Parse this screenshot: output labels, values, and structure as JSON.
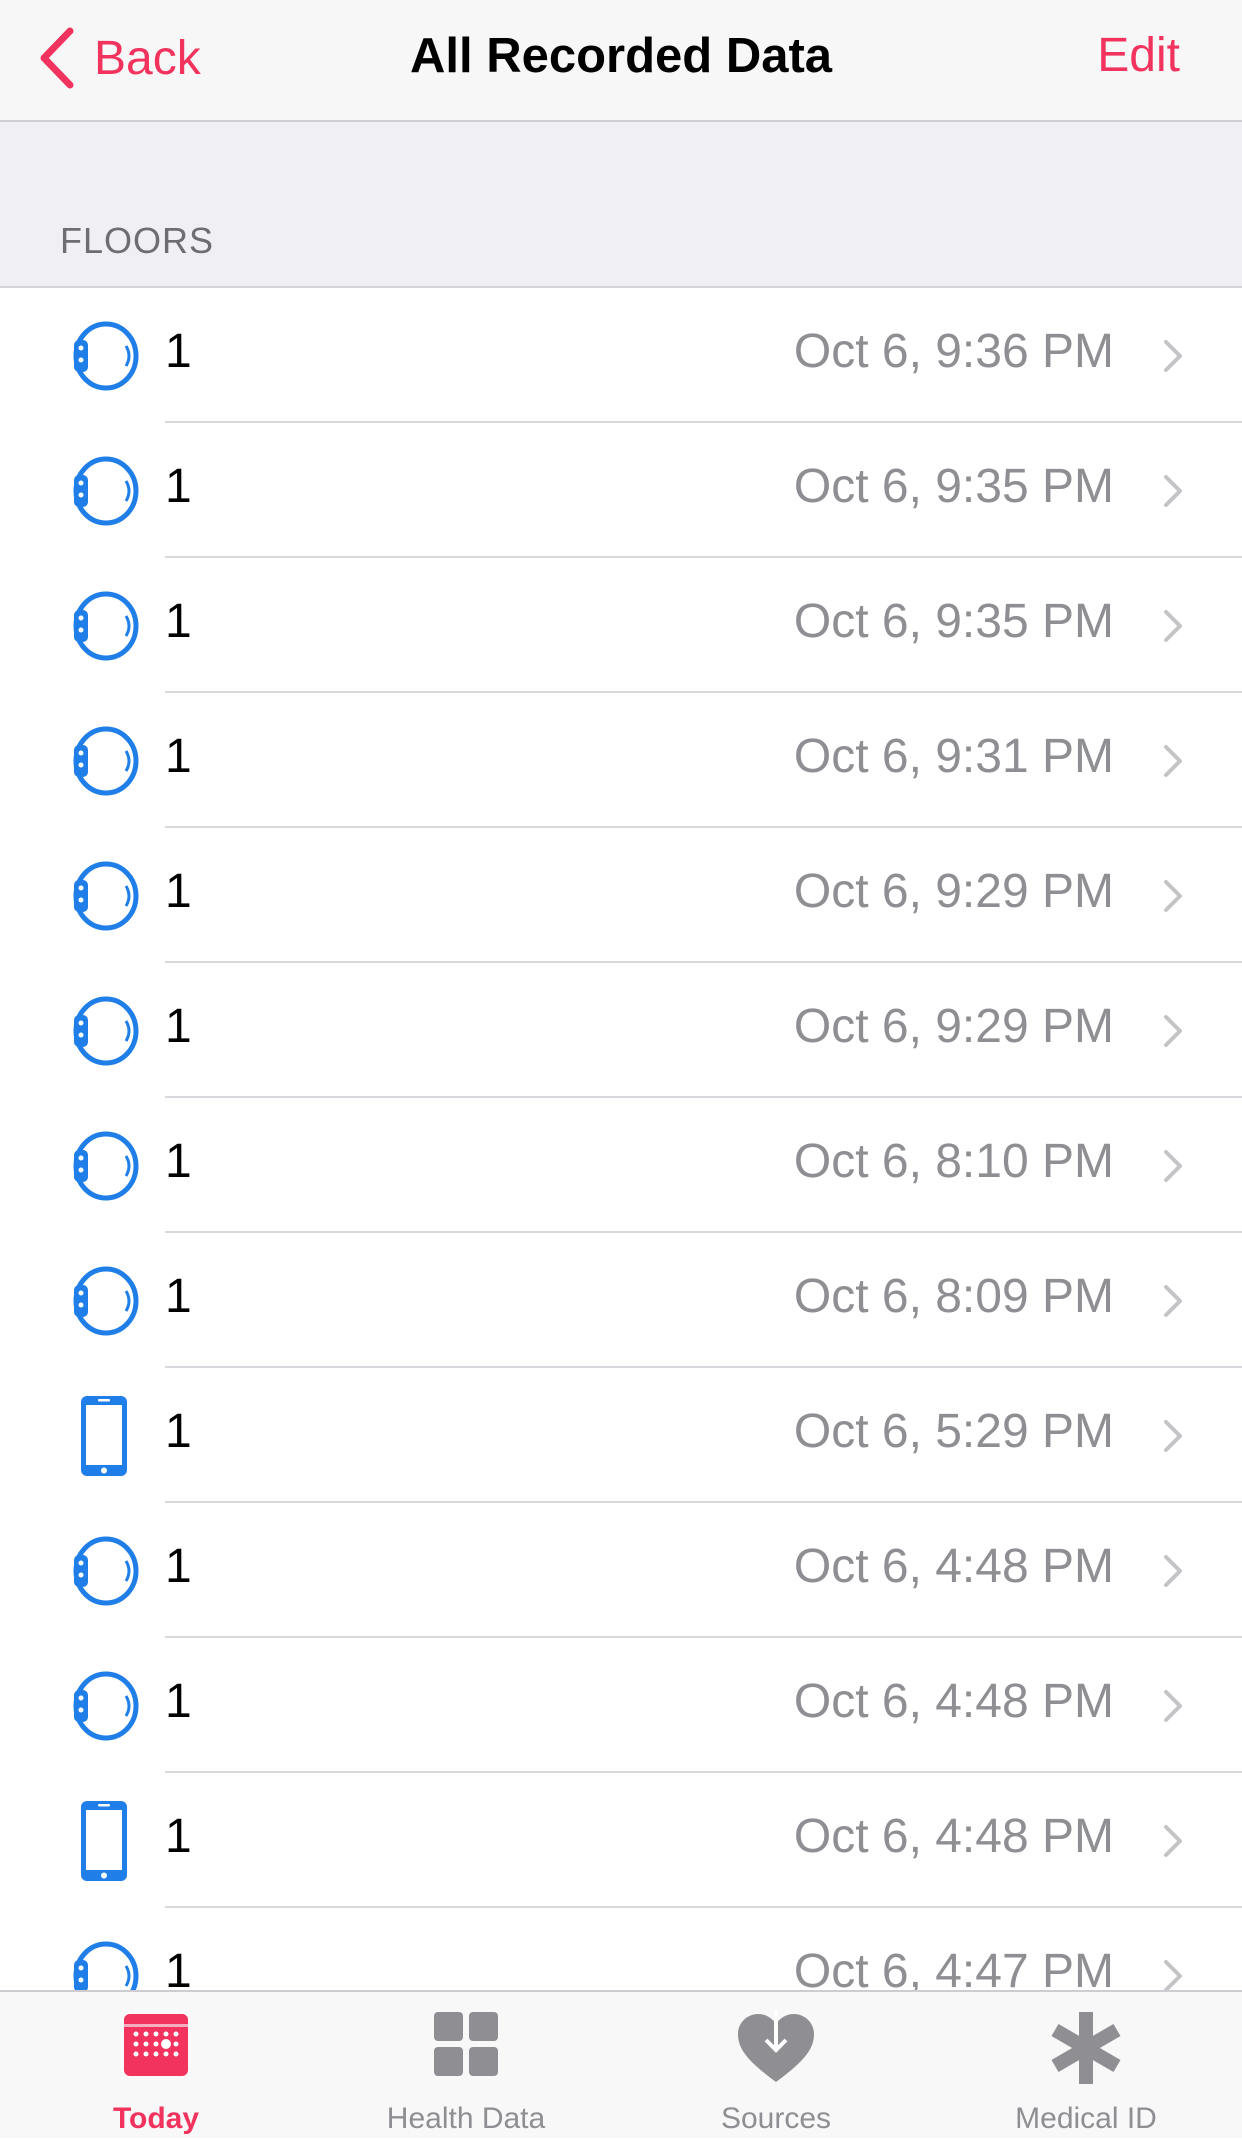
{
  "nav": {
    "back_label": "Back",
    "title": "All Recorded Data",
    "edit_label": "Edit"
  },
  "section": {
    "title": "FLOORS"
  },
  "records": [
    {
      "device": "watch-icon",
      "value": "1",
      "date": "Oct 6, 9:36 PM"
    },
    {
      "device": "watch-icon",
      "value": "1",
      "date": "Oct 6, 9:35 PM"
    },
    {
      "device": "watch-icon",
      "value": "1",
      "date": "Oct 6, 9:35 PM"
    },
    {
      "device": "watch-icon",
      "value": "1",
      "date": "Oct 6, 9:31 PM"
    },
    {
      "device": "watch-icon",
      "value": "1",
      "date": "Oct 6, 9:29 PM"
    },
    {
      "device": "watch-icon",
      "value": "1",
      "date": "Oct 6, 9:29 PM"
    },
    {
      "device": "watch-icon",
      "value": "1",
      "date": "Oct 6, 8:10 PM"
    },
    {
      "device": "watch-icon",
      "value": "1",
      "date": "Oct 6, 8:09 PM"
    },
    {
      "device": "iphone-icon",
      "value": "1",
      "date": "Oct 6, 5:29 PM"
    },
    {
      "device": "watch-icon",
      "value": "1",
      "date": "Oct 6, 4:48 PM"
    },
    {
      "device": "watch-icon",
      "value": "1",
      "date": "Oct 6, 4:48 PM"
    },
    {
      "device": "iphone-icon",
      "value": "1",
      "date": "Oct 6, 4:48 PM"
    },
    {
      "device": "watch-icon",
      "value": "1",
      "date": "Oct 6, 4:47 PM"
    }
  ],
  "tabs": [
    {
      "label": "Today",
      "icon": "calendar-icon",
      "active": true
    },
    {
      "label": "Health Data",
      "icon": "grid-icon",
      "active": false
    },
    {
      "label": "Sources",
      "icon": "heart-download-icon",
      "active": false
    },
    {
      "label": "Medical ID",
      "icon": "asterisk-icon",
      "active": false
    }
  ],
  "colors": {
    "accent": "#f2335e",
    "device_blue": "#1f7ee8",
    "secondary_text": "#8e8e93",
    "inactive_tab": "#8e8e93"
  }
}
